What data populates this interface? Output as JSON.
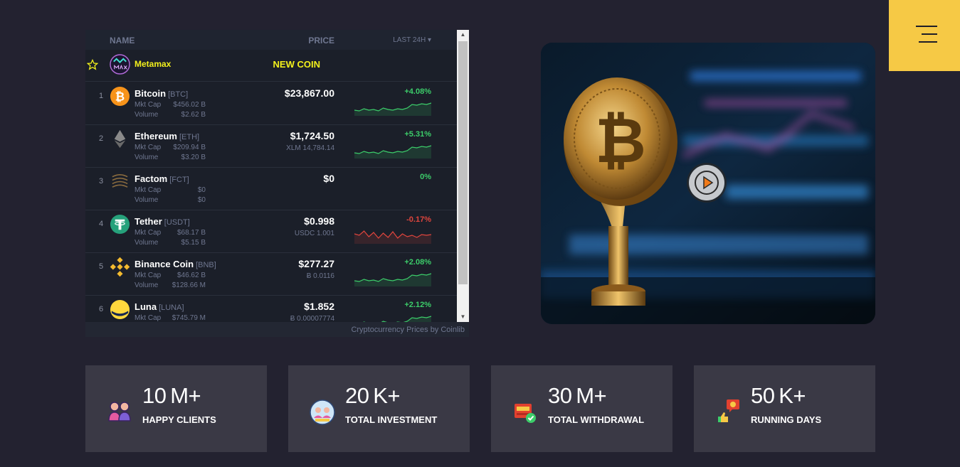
{
  "menu": {
    "icon": "hamburger-menu-icon",
    "color": "#f6c945"
  },
  "widget": {
    "header": {
      "name": "NAME",
      "price": "PRICE",
      "last": "LAST 24H ▾"
    },
    "featured": {
      "name": "Metamax",
      "badge": "NEW COIN",
      "icon": "metamax-logo-icon"
    },
    "coins": [
      {
        "rank": "1",
        "name": "Bitcoin",
        "symbol": "[BTC]",
        "mktcap_label": "Mkt Cap",
        "mktcap": "$456.02 B",
        "volume_label": "Volume",
        "volume": "$2.62 B",
        "price": "$23,867.00",
        "subprice": "",
        "change": "+4.08%",
        "trend": "up",
        "icon": "bitcoin-icon"
      },
      {
        "rank": "2",
        "name": "Ethereum",
        "symbol": "[ETH]",
        "mktcap_label": "Mkt Cap",
        "mktcap": "$209.94 B",
        "volume_label": "Volume",
        "volume": "$3.20 B",
        "price": "$1,724.50",
        "subprice": "XLM 14,784.14",
        "change": "+5.31%",
        "trend": "up",
        "icon": "ethereum-icon"
      },
      {
        "rank": "3",
        "name": "Factom",
        "symbol": "[FCT]",
        "mktcap_label": "Mkt Cap",
        "mktcap": "$0",
        "volume_label": "Volume",
        "volume": "$0",
        "price": "$0",
        "subprice": "",
        "change": "0%",
        "trend": "flat",
        "icon": "factom-icon"
      },
      {
        "rank": "4",
        "name": "Tether",
        "symbol": "[USDT]",
        "mktcap_label": "Mkt Cap",
        "mktcap": "$68.17 B",
        "volume_label": "Volume",
        "volume": "$5.15 B",
        "price": "$0.998",
        "subprice": "USDC 1.001",
        "change": "-0.17%",
        "trend": "down",
        "icon": "tether-icon"
      },
      {
        "rank": "5",
        "name": "Binance Coin",
        "symbol": "[BNB]",
        "mktcap_label": "Mkt Cap",
        "mktcap": "$46.62 B",
        "volume_label": "Volume",
        "volume": "$128.66 M",
        "price": "$277.27",
        "subprice": "Ƀ 0.0116",
        "change": "+2.08%",
        "trend": "up",
        "icon": "binance-coin-icon"
      },
      {
        "rank": "6",
        "name": "Luna",
        "symbol": "[LUNA]",
        "mktcap_label": "Mkt Cap",
        "mktcap": "$745.79 M",
        "volume_label": "",
        "volume": "",
        "price": "$1.852",
        "subprice": "Ƀ 0.00007774",
        "change": "+2.12%",
        "trend": "up",
        "icon": "luna-icon"
      }
    ],
    "footer": "Cryptocurrency Prices by Coinlib"
  },
  "video": {
    "icon": "play-icon",
    "image": "bitcoin-coin-photo"
  },
  "stats": [
    {
      "number": "10 M+",
      "label": "HAPPY CLIENTS",
      "icon": "happy-clients-icon"
    },
    {
      "number": "20 K+",
      "label": "TOTAL INVESTMENT",
      "icon": "investment-icon"
    },
    {
      "number": "30 M+",
      "label": "TOTAL WITHDRAWAL",
      "icon": "withdrawal-icon"
    },
    {
      "number": "50 K+",
      "label": "RUNNING DAYS",
      "icon": "running-days-icon"
    }
  ],
  "colors": {
    "up": "#3ccd6a",
    "down": "#e0453d",
    "featured": "#f3f01c",
    "accent": "#f6c945"
  }
}
